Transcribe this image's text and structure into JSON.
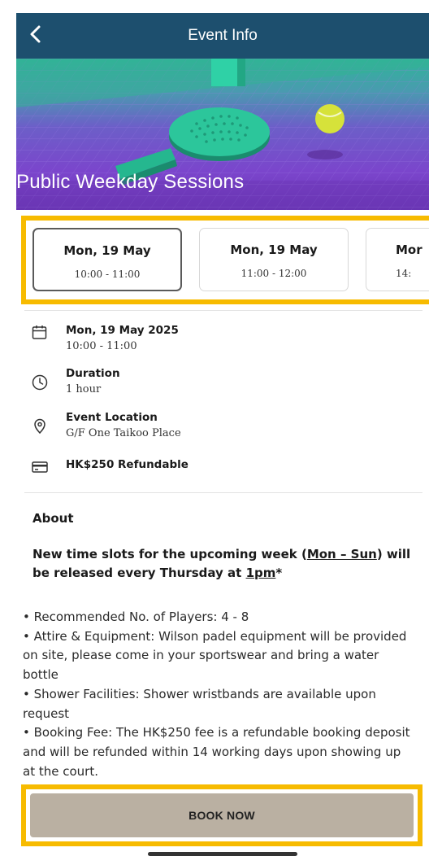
{
  "header": {
    "title": "Event Info",
    "back_icon": "chevron-left-icon",
    "background": "#1d4f6e"
  },
  "hero": {
    "title": "Public Weekday Sessions"
  },
  "slots": [
    {
      "date": "Mon, 19 May",
      "time": "10:00 - 11:00",
      "selected": true
    },
    {
      "date": "Mon, 19 May",
      "time": "11:00 - 12:00",
      "selected": false
    },
    {
      "date": "Mor",
      "time": "14:",
      "selected": false
    }
  ],
  "details": {
    "date": {
      "icon": "calendar-icon",
      "title": "Mon, 19 May 2025",
      "sub": "10:00 - 11:00"
    },
    "duration": {
      "icon": "clock-icon",
      "title": "Duration",
      "sub": "1 hour"
    },
    "location": {
      "icon": "location-pin-icon",
      "title": "Event Location",
      "sub": "G/F One Taikoo Place"
    },
    "price": {
      "icon": "credit-card-icon",
      "title": "HK$250 Refundable"
    }
  },
  "about": {
    "heading": "About",
    "announce_part1": "New time slots for the upcoming week (",
    "announce_link1": "Mon – Sun",
    "announce_part2": ") will be released every Thursday at ",
    "announce_link2": "1pm",
    "announce_part3": "*",
    "line1": "• Recommended No. of Players: 4 - 8",
    "line2": "• Attire & Equipment: Wilson padel equipment will be provided on site, please come in your sportswear and bring a water bottle",
    "line3": "• Shower Facilities: Shower wristbands are available upon request",
    "line4": "• Booking Fee: The HK$250 fee is a refundable booking deposit and will be refunded within 14 working days upon showing up at the court."
  },
  "footer": {
    "book_label": "BOOK NOW"
  },
  "colors": {
    "highlight": "#f7bb00",
    "book_button": "#bab0a2"
  }
}
